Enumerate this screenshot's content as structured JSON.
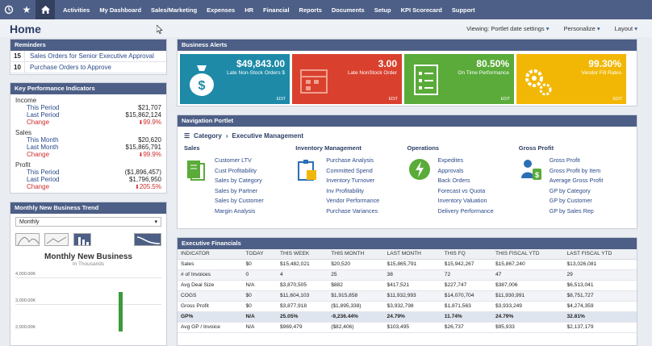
{
  "nav": [
    "Activities",
    "My Dashboard",
    "Sales/Marketing",
    "Expenses",
    "HR",
    "Financial",
    "Reports",
    "Documents",
    "Setup",
    "KPI Scorecard",
    "Support"
  ],
  "page": {
    "title": "Home",
    "links": [
      "Viewing: Portlet date settings",
      "Personalize",
      "Layout"
    ]
  },
  "reminders": {
    "title": "Reminders",
    "items": [
      {
        "count": "15",
        "text": "Sales Orders for Senior Executive Approval"
      },
      {
        "count": "10",
        "text": "Purchase Orders to Approve"
      }
    ]
  },
  "kpi": {
    "title": "Key Performance Indicators",
    "groups": [
      {
        "name": "Income",
        "rows": [
          {
            "label": "This Period",
            "value": "$21,707"
          },
          {
            "label": "Last Period",
            "value": "$15,862,124"
          },
          {
            "label": "Change",
            "value": "99.9%"
          }
        ]
      },
      {
        "name": "Sales",
        "rows": [
          {
            "label": "This Month",
            "value": "$20,620"
          },
          {
            "label": "Last Month",
            "value": "$15,865,791"
          },
          {
            "label": "Change",
            "value": "99.9%"
          }
        ]
      },
      {
        "name": "Profit",
        "rows": [
          {
            "label": "This Period",
            "value": "($1,896,457)"
          },
          {
            "label": "Last Period",
            "value": "$1,796,950"
          },
          {
            "label": "Change",
            "value": "205.5%"
          }
        ]
      }
    ]
  },
  "trend": {
    "title": "Monthly New Business Trend",
    "select": "Monthly",
    "chart_title": "Monthly New Business",
    "chart_sub": "In Thousands",
    "y_ticks": [
      "4,000.00K",
      "3,000.00K",
      "2,000.00K"
    ]
  },
  "alerts": {
    "title": "Business Alerts",
    "edit_label": "EDIT",
    "tiles": [
      {
        "amount": "$49,843.00",
        "desc": "Late Non-Stock Orders $",
        "color": "#1e8aa8",
        "icon": "money-bag-icon"
      },
      {
        "amount": "3.00",
        "desc": "Late NonStock Order",
        "color": "#d9412e",
        "icon": "calendar-icon"
      },
      {
        "amount": "80.50%",
        "desc": "On Time Performance",
        "color": "#5aab3a",
        "icon": "checklist-icon"
      },
      {
        "amount": "99.30%",
        "desc": "Vendor Fill Rates",
        "color": "#f2b705",
        "icon": "gears-icon"
      }
    ]
  },
  "navportlet": {
    "title": "Navigation Portlet",
    "crumb_1": "Category",
    "crumb_2": "Executive Management",
    "categories": [
      {
        "title": "Sales",
        "color": "#5aab3a",
        "items": [
          "Customer LTV",
          "Cust Profitability",
          "Sales by Category",
          "Sales by Partner",
          "Sales by Customer",
          "Margin Analysis"
        ]
      },
      {
        "title": "Inventory Management",
        "color": "#2b6fb5",
        "items": [
          "Purchase Analysis",
          "Committed Spend",
          "Inventory Turnover",
          "Inv Profitability",
          "Vendor Performance",
          "Purchase Variances"
        ]
      },
      {
        "title": "Operations",
        "color": "#5aab3a",
        "items": [
          "Expedites",
          "Approvals",
          "Back Orders",
          "Forecast vs Quota",
          "Inventory Valuation",
          "Delivery Performance"
        ]
      },
      {
        "title": "Gross Profit",
        "color": "#2b6fb5",
        "items": [
          "Gross Profit",
          "Gross Profit by Item",
          "Average Gross Profit",
          "GP by Category",
          "GP by Customer",
          "GP by Sales Rep"
        ]
      }
    ]
  },
  "financials": {
    "title": "Executive Financials",
    "columns": [
      "INDICATOR",
      "TODAY",
      "THIS WEEK",
      "THIS MONTH",
      "LAST MONTH",
      "THIS FQ",
      "THIS FISCAL YTD",
      "LAST FISCAL YTD"
    ],
    "rows": [
      [
        "Sales",
        "$0",
        "$15,482,021",
        "$20,520",
        "$15,865,791",
        "$15,942,267",
        "$15,867,240",
        "$13,026,081"
      ],
      [
        "# of Invoices",
        "0",
        "4",
        "25",
        "38",
        "72",
        "47",
        "29"
      ],
      [
        "Avg Deal Size",
        "N/A",
        "$3,870,505",
        "$882",
        "$417,521",
        "$227,747",
        "$387,006",
        "$6,513,041"
      ],
      [
        "COGS",
        "$0",
        "$11,604,103",
        "$1,915,858",
        "$11,932,993",
        "$14,070,704",
        "$11,930,991",
        "$8,751,727"
      ],
      [
        "Gross Profit",
        "$0",
        "$3,877,918",
        "($1,895,338)",
        "$3,932,798",
        "$1,871,563",
        "$3,933,249",
        "$4,274,359"
      ],
      [
        "GP%",
        "N/A",
        "25.05%",
        "-9,236.44%",
        "24.79%",
        "11.74%",
        "24.79%",
        "32.81%"
      ],
      [
        "Avg GP / Invoice",
        "N/A",
        "$969,479",
        "($82,406)",
        "$103,495",
        "$26,737",
        "$95,933",
        "$2,137,179"
      ]
    ]
  }
}
